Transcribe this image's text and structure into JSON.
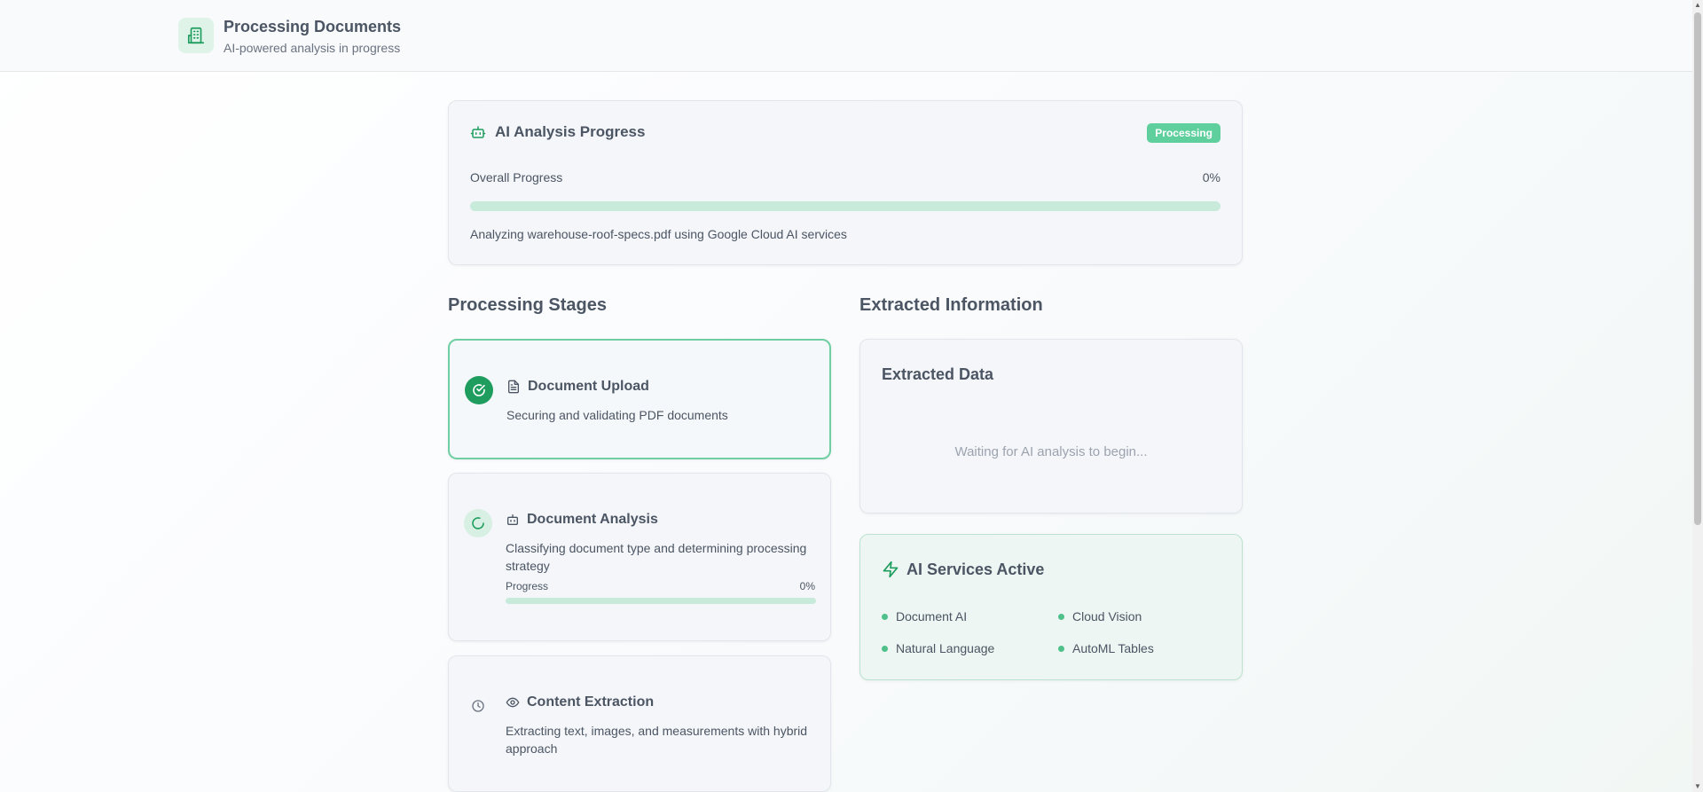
{
  "header": {
    "title": "Processing Documents",
    "subtitle": "AI-powered analysis in progress",
    "logo_icon": "building-icon"
  },
  "progress": {
    "title": "AI Analysis Progress",
    "badge": "Processing",
    "overall_label": "Overall Progress",
    "overall_pct_text": "0%",
    "overall_fraction": 0,
    "analyzing_text": "Analyzing warehouse-roof-specs.pdf using Google Cloud AI services"
  },
  "stages_section": {
    "title": "Processing Stages",
    "stages": [
      {
        "title": "Document Upload",
        "description": "Securing and validating PDF documents",
        "status": "completed",
        "icon": "file-icon"
      },
      {
        "title": "Document Analysis",
        "description": "Classifying document type and determining processing strategy",
        "status": "in-progress",
        "icon": "robot-icon",
        "progress_label": "Progress",
        "progress_pct_text": "0%",
        "progress_fraction": 0
      },
      {
        "title": "Content Extraction",
        "description": "Extracting text, images, and measurements with hybrid approach",
        "status": "pending",
        "icon": "eye-icon"
      }
    ]
  },
  "extracted_section": {
    "title": "Extracted Information",
    "card_title": "Extracted Data",
    "waiting_text": "Waiting for AI analysis to begin..."
  },
  "services": {
    "title": "AI Services Active",
    "items": [
      "Document AI",
      "Cloud Vision",
      "Natural Language",
      "AutoML Tables"
    ]
  },
  "colors": {
    "accent": "#22a968",
    "badge": "#5fcf9d",
    "track": "#c8eadb"
  }
}
